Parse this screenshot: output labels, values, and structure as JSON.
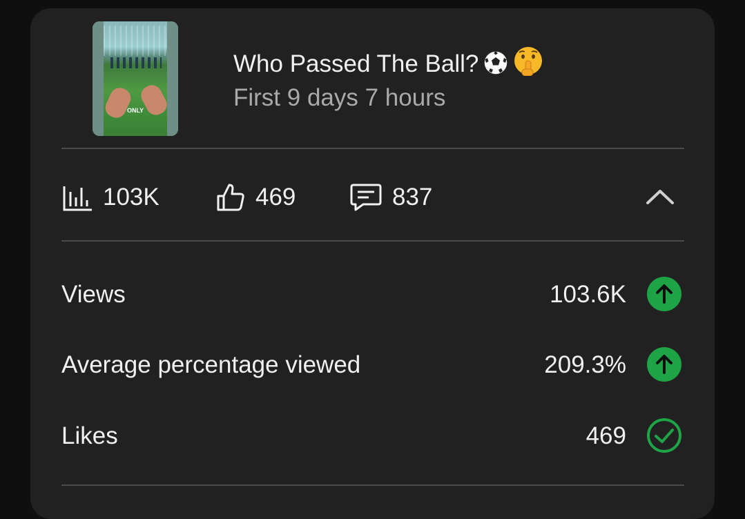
{
  "video": {
    "title": "Who Passed The Ball?",
    "title_emojis": [
      "soccer-ball-icon",
      "shushing-face-icon"
    ],
    "period": "First 9 days 7 hours",
    "thumbnail_caption": "ONLY"
  },
  "summary": {
    "views": "103K",
    "likes": "469",
    "comments": "837",
    "icons": [
      "bar-chart-icon",
      "thumbs-up-icon",
      "comment-icon",
      "chevron-up-icon"
    ]
  },
  "metrics": [
    {
      "label": "Views",
      "value": "103.6K",
      "status": "up-arrow-icon"
    },
    {
      "label": "Average percentage viewed",
      "value": "209.3%",
      "status": "up-arrow-icon"
    },
    {
      "label": "Likes",
      "value": "469",
      "status": "check-icon"
    }
  ],
  "colors": {
    "background": "#0f0f0f",
    "card": "#212121",
    "divider": "#4a4a4a",
    "text_primary": "#f1f1f1",
    "text_secondary": "#aaaaaa",
    "accent_green": "#1ea446"
  }
}
